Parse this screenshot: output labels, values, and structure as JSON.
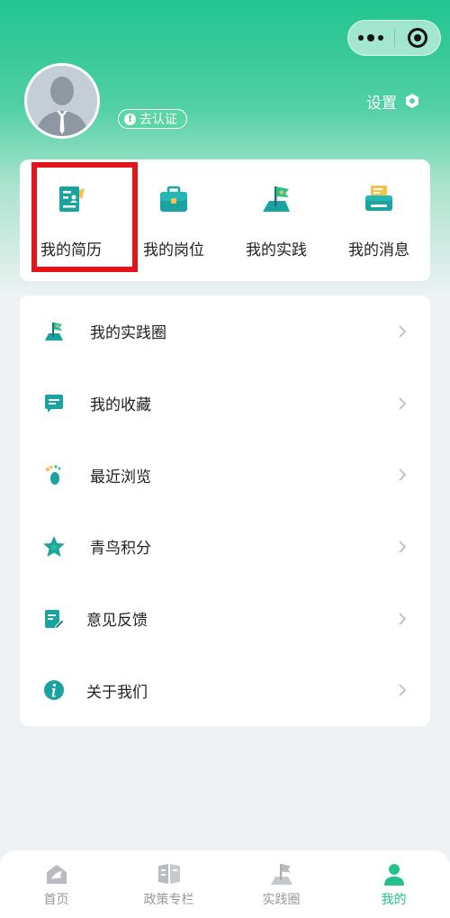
{
  "header": {
    "verify_label": "去认证",
    "settings_label": "设置"
  },
  "quick_actions": [
    {
      "label": "我的简历"
    },
    {
      "label": "我的岗位"
    },
    {
      "label": "我的实践"
    },
    {
      "label": "我的消息"
    }
  ],
  "menu": [
    {
      "label": "我的实践圈"
    },
    {
      "label": "我的收藏"
    },
    {
      "label": "最近浏览"
    },
    {
      "label": "青鸟积分"
    },
    {
      "label": "意见反馈"
    },
    {
      "label": "关于我们"
    }
  ],
  "tabbar": [
    {
      "label": "首页"
    },
    {
      "label": "政策专栏"
    },
    {
      "label": "实践圈"
    },
    {
      "label": "我的"
    }
  ],
  "colors": {
    "accent": "#24c18d",
    "highlight_box": "#e4141b",
    "icon_teal": "#1ea3a3"
  }
}
